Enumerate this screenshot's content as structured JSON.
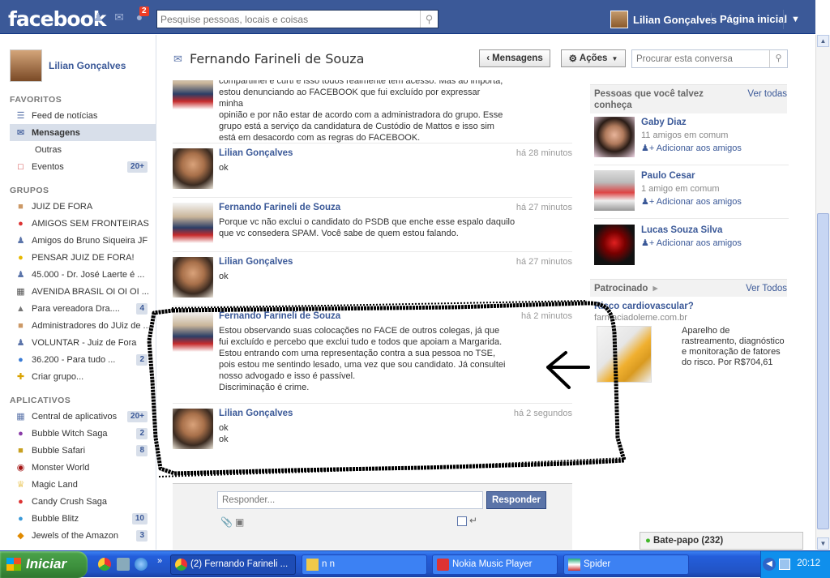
{
  "header": {
    "logo": "facebook",
    "notification_count": "2",
    "search_placeholder": "Pesquise pessoas, locais e coisas",
    "user_name": "Lilian Gonçalves",
    "home_label": "Página inicial"
  },
  "sidebar": {
    "profile_name": "Lilian Gonçalves",
    "favorites_title": "FAVORITOS",
    "favorites": [
      {
        "label": "Feed de notícias",
        "icon": "news-feed-icon",
        "count": ""
      },
      {
        "label": "Mensagens",
        "icon": "messages-icon",
        "count": ""
      },
      {
        "label": "Outras",
        "icon": "",
        "count": ""
      },
      {
        "label": "Eventos",
        "icon": "calendar-icon",
        "count": "20+"
      }
    ],
    "groups_title": "GRUPOS",
    "groups": [
      {
        "label": "JUIZ DE FORA",
        "count": ""
      },
      {
        "label": "AMIGOS SEM FRONTEIRAS",
        "count": ""
      },
      {
        "label": "Amigos do Bruno Siqueira JF",
        "count": ""
      },
      {
        "label": "PENSAR JUIZ DE FORA!",
        "count": ""
      },
      {
        "label": "45.000 - Dr. José Laerte é ...",
        "count": ""
      },
      {
        "label": "AVENIDA BRASIL OI OI OI ...",
        "count": ""
      },
      {
        "label": "Para vereadora Dra....",
        "count": "4"
      },
      {
        "label": "Administradores do JUiz de ...",
        "count": ""
      },
      {
        "label": "VOLUNTAR - Juiz de Fora",
        "count": ""
      },
      {
        "label": "36.200 - Para tudo ...",
        "count": "2"
      },
      {
        "label": "Criar grupo...",
        "count": ""
      }
    ],
    "apps_title": "APLICATIVOS",
    "apps": [
      {
        "label": "Central de aplicativos",
        "count": "20+"
      },
      {
        "label": "Bubble Witch Saga",
        "count": "2"
      },
      {
        "label": "Bubble Safari",
        "count": "8"
      },
      {
        "label": "Monster World",
        "count": ""
      },
      {
        "label": "Magic Land",
        "count": ""
      },
      {
        "label": "Candy Crush Saga",
        "count": ""
      },
      {
        "label": "Bubble Blitz",
        "count": "10"
      },
      {
        "label": "Jewels of the Amazon",
        "count": "3"
      }
    ]
  },
  "conversation": {
    "title": "Fernando Farineli de Souza",
    "back_label": "Mensagens",
    "actions_label": "Ações",
    "search_placeholder": "Procurar esta conversa",
    "messages": [
      {
        "author": "Fernando Farineli de Souza",
        "time": "",
        "text": "Você sabe que não infringi regra alguma, ai AI Amaro Muniz, somente\ncompartilhei e curti e isso todos realmente tem acesso. Mas ao importa,\nestou denunciando ao FACEBOOK que fui excluído por expressar minha\nopinião e por não estar de acordo com a administradora do grupo. Esse\ngrupo está a serviço da candidatura de Custódio de Mattos e isso sim\nestá em desacordo com as regras do FACEBOOK.",
        "avatar": "fern"
      },
      {
        "author": "Lilian Gonçalves",
        "time": "há 28 minutos",
        "text": "ok",
        "avatar": "lilian"
      },
      {
        "author": "Fernando Farineli de Souza",
        "time": "há 27 minutos",
        "text": "Porque vc não exclui o candidato do PSDB que enche esse espalo daquilo\nque vc consedera SPAM. Você sabe de quem estou falando.",
        "avatar": "fern"
      },
      {
        "author": "Lilian Gonçalves",
        "time": "há 27 minutos",
        "text": "ok",
        "avatar": "lilian"
      },
      {
        "author": "Fernando Farineli de Souza",
        "time": "há 2 minutos",
        "text": "Estou observando suas colocações no FACE de outros colegas, já que\nfui excluído e percebo que exclui tudo e todos que apoiam a Margarida.\nEstou entrando com uma representação contra a sua pessoa no TSE,\npois estou me sentindo lesado, uma vez que sou candidato. Já consultei\nnosso advogado e isso é passível.\nDiscriminação é crime.",
        "avatar": "fern"
      },
      {
        "author": "Lilian Gonçalves",
        "time": "há 2 segundos",
        "text": "ok\nok",
        "avatar": "lilian"
      }
    ],
    "reply_placeholder": "Responder...",
    "reply_button": "Responder"
  },
  "suggestions": {
    "title": "Pessoas que você talvez conheça",
    "see_all": "Ver todas",
    "people": [
      {
        "name": "Gaby Diaz",
        "mutual": "11 amigos em comum",
        "action": "Adicionar aos amigos"
      },
      {
        "name": "Paulo Cesar",
        "mutual": "1 amigo em comum",
        "action": "Adicionar aos amigos"
      },
      {
        "name": "Lucas Souza Silva",
        "mutual": "",
        "action": "Adicionar aos amigos"
      }
    ]
  },
  "sponsored": {
    "title": "Patrocinado",
    "see_all": "Ver Todos",
    "ad_title": "Risco cardiovascular?",
    "ad_domain": "farmaciadoleme.com.br",
    "ad_text": "Aparelho de rastreamento, diagnóstico e monitoração de fatores do risco. Por R$704,61"
  },
  "chat": {
    "label": "Bate-papo (232)"
  },
  "taskbar": {
    "start_label": "Iniciar",
    "tasks": [
      "(2) Fernando Farineli ...",
      "n n",
      "Nokia Music Player",
      "Spider"
    ],
    "clock": "20:12"
  },
  "colors": {
    "brand": "#3b5998",
    "sidebar_selected": "#d8dfea",
    "taskbar": "#245edb",
    "start": "#3c8f3c"
  }
}
